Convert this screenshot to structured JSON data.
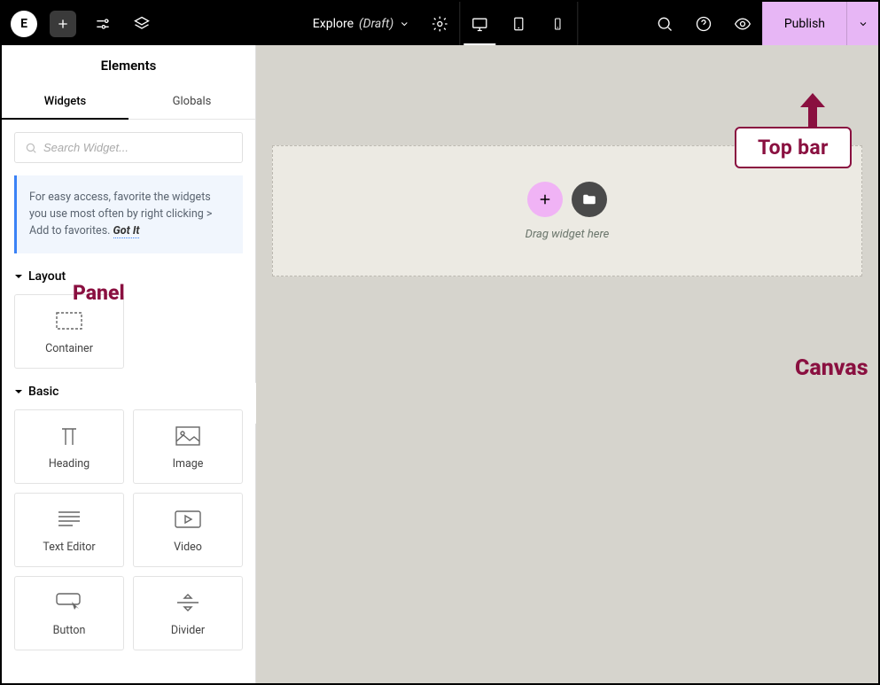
{
  "topbar": {
    "logo_text": "E",
    "doc_name": "Explore",
    "doc_status": "(Draft)",
    "publish_label": "Publish"
  },
  "panel": {
    "title": "Elements",
    "tabs": {
      "widgets": "Widgets",
      "globals": "Globals"
    },
    "search_placeholder": "Search Widget...",
    "tip_text": "For easy access, favorite the widgets you use most often by right clicking > Add to favorites.",
    "tip_gotit": "Got It",
    "sections": {
      "layout": {
        "title": "Layout",
        "items": [
          "Container"
        ]
      },
      "basic": {
        "title": "Basic",
        "items": [
          "Heading",
          "Image",
          "Text Editor",
          "Video",
          "Button",
          "Divider"
        ]
      }
    }
  },
  "canvas": {
    "drop_label": "Drag widget here"
  },
  "annotations": {
    "topbar": "Top bar",
    "panel": "Panel",
    "canvas": "Canvas"
  }
}
